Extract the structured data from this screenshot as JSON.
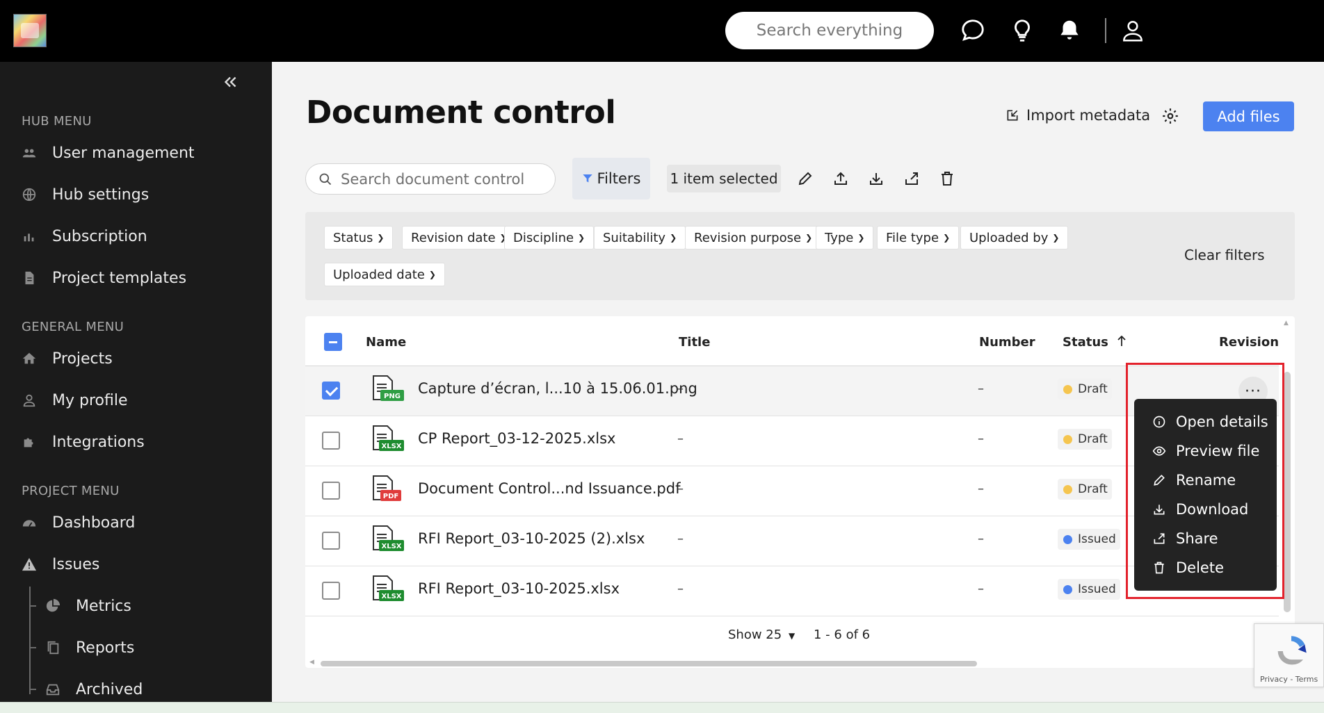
{
  "topbar": {
    "search_placeholder": "Search everything",
    "icons": [
      "chat-icon",
      "lightbulb-icon",
      "bell-icon",
      "user-icon"
    ]
  },
  "sidebar": {
    "hub_heading": "HUB MENU",
    "hub_items": [
      {
        "label": "User management",
        "icon": "users-icon"
      },
      {
        "label": "Hub settings",
        "icon": "globe-icon"
      },
      {
        "label": "Subscription",
        "icon": "chart-icon"
      },
      {
        "label": "Project templates",
        "icon": "document-icon"
      }
    ],
    "general_heading": "GENERAL MENU",
    "general_items": [
      {
        "label": "Projects",
        "icon": "home-icon"
      },
      {
        "label": "My profile",
        "icon": "user-icon"
      },
      {
        "label": "Integrations",
        "icon": "puzzle-icon"
      }
    ],
    "project_heading": "PROJECT MENU",
    "project_items": [
      {
        "label": "Dashboard",
        "icon": "gauge-icon"
      },
      {
        "label": "Issues",
        "icon": "warning-icon"
      }
    ],
    "issues_sub_items": [
      {
        "label": "Metrics",
        "icon": "pie-icon"
      },
      {
        "label": "Reports",
        "icon": "copy-icon"
      },
      {
        "label": "Archived",
        "icon": "inbox-icon"
      }
    ]
  },
  "main": {
    "title": "Document control",
    "import_label": "Import metadata",
    "add_files_label": "Add files",
    "search_placeholder": "Search document control",
    "filters_label": "Filters",
    "selected_label": "1 item selected",
    "filter_chips": [
      "Status",
      "Revision date",
      "Discipline",
      "Suitability",
      "Revision purpose",
      "Type",
      "File type",
      "Uploaded by",
      "Uploaded date"
    ],
    "clear_filters_label": "Clear filters"
  },
  "table": {
    "columns": {
      "name": "Name",
      "title": "Title",
      "number": "Number",
      "status": "Status",
      "revision": "Revision"
    },
    "rows": [
      {
        "name": "Capture d’écran, l...10 à 15.06.01.png",
        "type": "PNG",
        "type_color": "#2f9e44",
        "title": "–",
        "number": "–",
        "status": "Draft",
        "status_color": "#f5c54f",
        "selected": true
      },
      {
        "name": "CP Report_03-12-2025.xlsx",
        "type": "XLSX",
        "type_color": "#1e8c2f",
        "title": "–",
        "number": "–",
        "status": "Draft",
        "status_color": "#f5c54f",
        "selected": false
      },
      {
        "name": "Document Control...nd Issuance.pdf",
        "type": "PDF",
        "type_color": "#e03c3c",
        "title": "–",
        "number": "–",
        "status": "Draft",
        "status_color": "#f5c54f",
        "selected": false
      },
      {
        "name": "RFI Report_03-10-2025 (2).xlsx",
        "type": "XLSX",
        "type_color": "#1e8c2f",
        "title": "–",
        "number": "–",
        "status": "Issued",
        "status_color": "#4c82f0",
        "selected": false
      },
      {
        "name": "RFI Report_03-10-2025.xlsx",
        "type": "XLSX",
        "type_color": "#1e8c2f",
        "title": "–",
        "number": "–",
        "status": "Issued",
        "status_color": "#4c82f0",
        "selected": false
      }
    ],
    "more_label": "···",
    "pager_show": "Show 25",
    "pager_range": "1 - 6 of 6"
  },
  "context_menu": {
    "items": [
      {
        "label": "Open details",
        "icon": "info-icon"
      },
      {
        "label": "Preview file",
        "icon": "eye-icon"
      },
      {
        "label": "Rename",
        "icon": "pencil-icon"
      },
      {
        "label": "Download",
        "icon": "download-icon"
      },
      {
        "label": "Share",
        "icon": "share-icon"
      },
      {
        "label": "Delete",
        "icon": "trash-icon"
      }
    ]
  },
  "recaptcha": {
    "terms": "Privacy - Terms"
  },
  "colors": {
    "accent": "#4c82f0",
    "draft": "#f5c54f",
    "issued": "#4c82f0",
    "highlight": "#e3222c"
  }
}
